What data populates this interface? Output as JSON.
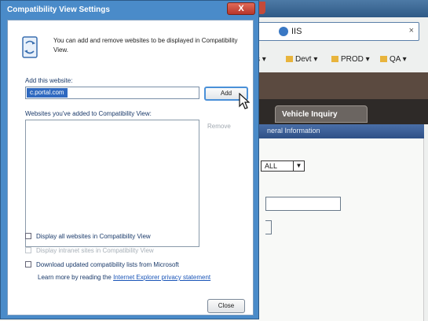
{
  "browser": {
    "address_text": "IIS",
    "address_close": "×",
    "favorites": [
      {
        "label": "s ▾",
        "folder": false
      },
      {
        "label": "Devt ▾",
        "folder": true
      },
      {
        "label": "PROD ▾",
        "folder": true
      },
      {
        "label": "QA ▾",
        "folder": true
      }
    ],
    "tab_label": "Vehicle Inquiry",
    "section_header": "neral Information",
    "select_value": "ALL"
  },
  "dialog": {
    "title": "Compatibility View Settings",
    "close_glyph": "X",
    "info_text": "You can add and remove websites to be displayed in Compatibility View.",
    "add_label": "Add this website:",
    "add_value": "c.portal.com",
    "add_button": "Add",
    "list_label": "Websites you've added to Compatibility View:",
    "remove_button": "Remove",
    "checkboxes": [
      {
        "label": "Display all websites in Compatibility View",
        "disabled": false
      },
      {
        "label": "Display intranet sites in Compatibility View",
        "disabled": true
      },
      {
        "label": "Download updated compatibility lists from Microsoft",
        "disabled": false
      }
    ],
    "learn_prefix": "Learn more by reading the",
    "learn_link": "Internet Explorer privacy statement",
    "close_button": "Close"
  }
}
